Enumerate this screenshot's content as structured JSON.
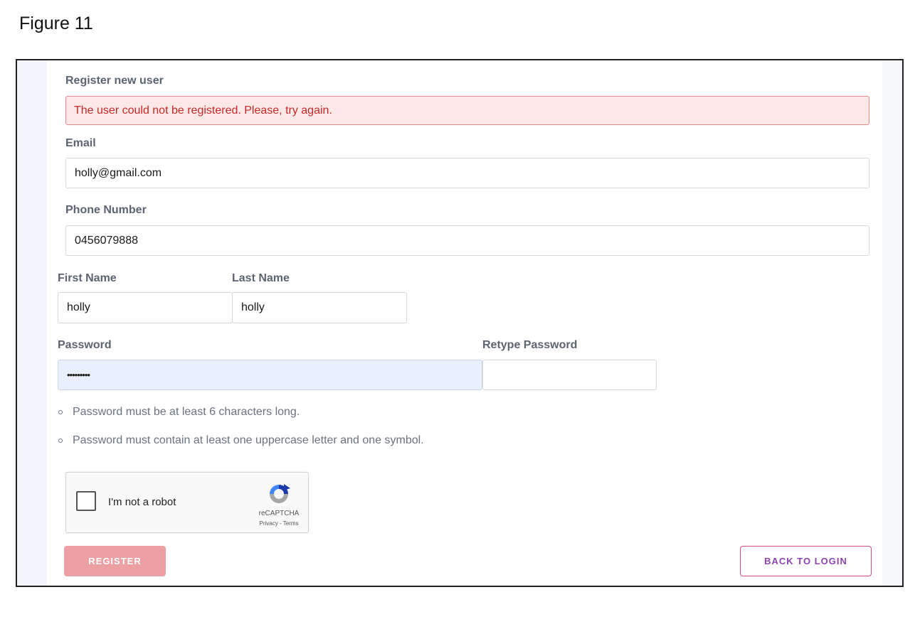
{
  "figure": {
    "caption": "Figure 11"
  },
  "form": {
    "title": "Register new user",
    "error_message": "The user could not be registered. Please, try again.",
    "email": {
      "label": "Email",
      "value": "holly@gmail.com"
    },
    "phone": {
      "label": "Phone Number",
      "value": "0456079888"
    },
    "first_name": {
      "label": "First Name",
      "value": "holly"
    },
    "last_name": {
      "label": "Last Name",
      "value": "holly"
    },
    "password": {
      "label": "Password",
      "value": "•••••••••"
    },
    "retype_password": {
      "label": "Retype Password",
      "value": ""
    },
    "password_rules": [
      "Password must be at least 6 characters long.",
      "Password must contain at least one uppercase letter and one symbol."
    ],
    "captcha": {
      "label": "I'm not a robot",
      "brand": "reCAPTCHA",
      "links": "Privacy - Terms",
      "icon": "recaptcha-logo-icon"
    },
    "register_button": "REGISTER",
    "back_button": "BACK TO LOGIN"
  },
  "colors": {
    "error_bg": "#fde8e8",
    "error_text": "#c62828",
    "register_button_bg": "#eca0a3",
    "back_button_text": "#8e44ad",
    "back_button_border": "#d44a86",
    "autofill_bg": "#e8f0fe"
  }
}
